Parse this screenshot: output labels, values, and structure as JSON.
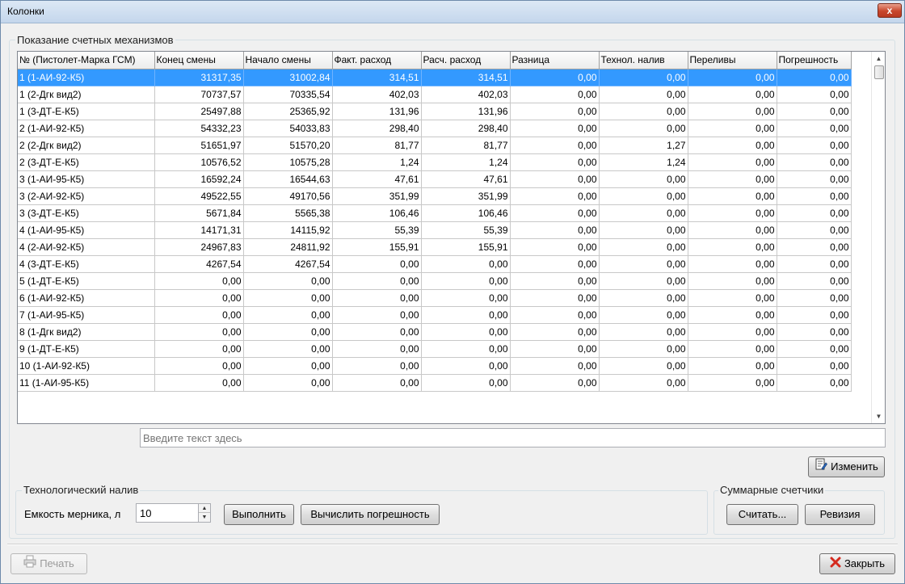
{
  "window": {
    "title": "Колонки",
    "close_glyph": "x"
  },
  "counters_group": {
    "label": "Показание счетных механизмов"
  },
  "grid": {
    "columns": [
      "№ (Пистолет-Марка ГСМ)",
      "Конец смены",
      "Начало смены",
      "Факт. расход",
      "Расч. расход",
      "Разница",
      "Технол. налив",
      "Переливы",
      "Погрешность"
    ],
    "rows": [
      [
        "1 (1-АИ-92-К5)",
        "31317,35",
        "31002,84",
        "314,51",
        "314,51",
        "0,00",
        "0,00",
        "0,00",
        "0,00"
      ],
      [
        "1 (2-Дгк вид2)",
        "70737,57",
        "70335,54",
        "402,03",
        "402,03",
        "0,00",
        "0,00",
        "0,00",
        "0,00"
      ],
      [
        "1 (3-ДТ-Е-К5)",
        "25497,88",
        "25365,92",
        "131,96",
        "131,96",
        "0,00",
        "0,00",
        "0,00",
        "0,00"
      ],
      [
        "2 (1-АИ-92-К5)",
        "54332,23",
        "54033,83",
        "298,40",
        "298,40",
        "0,00",
        "0,00",
        "0,00",
        "0,00"
      ],
      [
        "2 (2-Дгк вид2)",
        "51651,97",
        "51570,20",
        "81,77",
        "81,77",
        "0,00",
        "1,27",
        "0,00",
        "0,00"
      ],
      [
        "2 (3-ДТ-Е-К5)",
        "10576,52",
        "10575,28",
        "1,24",
        "1,24",
        "0,00",
        "1,24",
        "0,00",
        "0,00"
      ],
      [
        "3 (1-АИ-95-К5)",
        "16592,24",
        "16544,63",
        "47,61",
        "47,61",
        "0,00",
        "0,00",
        "0,00",
        "0,00"
      ],
      [
        "3 (2-АИ-92-К5)",
        "49522,55",
        "49170,56",
        "351,99",
        "351,99",
        "0,00",
        "0,00",
        "0,00",
        "0,00"
      ],
      [
        "3 (3-ДТ-Е-К5)",
        "5671,84",
        "5565,38",
        "106,46",
        "106,46",
        "0,00",
        "0,00",
        "0,00",
        "0,00"
      ],
      [
        "4 (1-АИ-95-К5)",
        "14171,31",
        "14115,92",
        "55,39",
        "55,39",
        "0,00",
        "0,00",
        "0,00",
        "0,00"
      ],
      [
        "4 (2-АИ-92-К5)",
        "24967,83",
        "24811,92",
        "155,91",
        "155,91",
        "0,00",
        "0,00",
        "0,00",
        "0,00"
      ],
      [
        "4 (3-ДТ-Е-К5)",
        "4267,54",
        "4267,54",
        "0,00",
        "0,00",
        "0,00",
        "0,00",
        "0,00",
        "0,00"
      ],
      [
        "5 (1-ДТ-Е-К5)",
        "0,00",
        "0,00",
        "0,00",
        "0,00",
        "0,00",
        "0,00",
        "0,00",
        "0,00"
      ],
      [
        "6 (1-АИ-92-К5)",
        "0,00",
        "0,00",
        "0,00",
        "0,00",
        "0,00",
        "0,00",
        "0,00",
        "0,00"
      ],
      [
        "7 (1-АИ-95-К5)",
        "0,00",
        "0,00",
        "0,00",
        "0,00",
        "0,00",
        "0,00",
        "0,00",
        "0,00"
      ],
      [
        "8 (1-Дгк вид2)",
        "0,00",
        "0,00",
        "0,00",
        "0,00",
        "0,00",
        "0,00",
        "0,00",
        "0,00"
      ],
      [
        "9 (1-ДТ-Е-К5)",
        "0,00",
        "0,00",
        "0,00",
        "0,00",
        "0,00",
        "0,00",
        "0,00",
        "0,00"
      ],
      [
        "10 (1-АИ-92-К5)",
        "0,00",
        "0,00",
        "0,00",
        "0,00",
        "0,00",
        "0,00",
        "0,00",
        "0,00"
      ],
      [
        "11 (1-АИ-95-К5)",
        "0,00",
        "0,00",
        "0,00",
        "0,00",
        "0,00",
        "0,00",
        "0,00",
        "0,00"
      ]
    ],
    "selected_row": 0
  },
  "text_field": {
    "placeholder": "Введите текст здесь"
  },
  "edit_button": {
    "label": "Изменить",
    "icon": "edit-document-icon"
  },
  "tech_fill": {
    "label": "Технологический налив",
    "capacity_label": "Емкость мерника, л",
    "capacity_value": "10",
    "run_button": "Выполнить",
    "calc_error_button": "Вычислить погрешность"
  },
  "total_counters": {
    "label": "Суммарные счетчики",
    "read_button": "Считать...",
    "revision_button": "Ревизия"
  },
  "footer": {
    "print_button": "Печать",
    "print_icon": "printer-icon",
    "close_button": "Закрыть",
    "close_icon": "red-x-icon"
  },
  "colors": {
    "selection": "#3399ff",
    "close_accent": "#c8462c"
  }
}
